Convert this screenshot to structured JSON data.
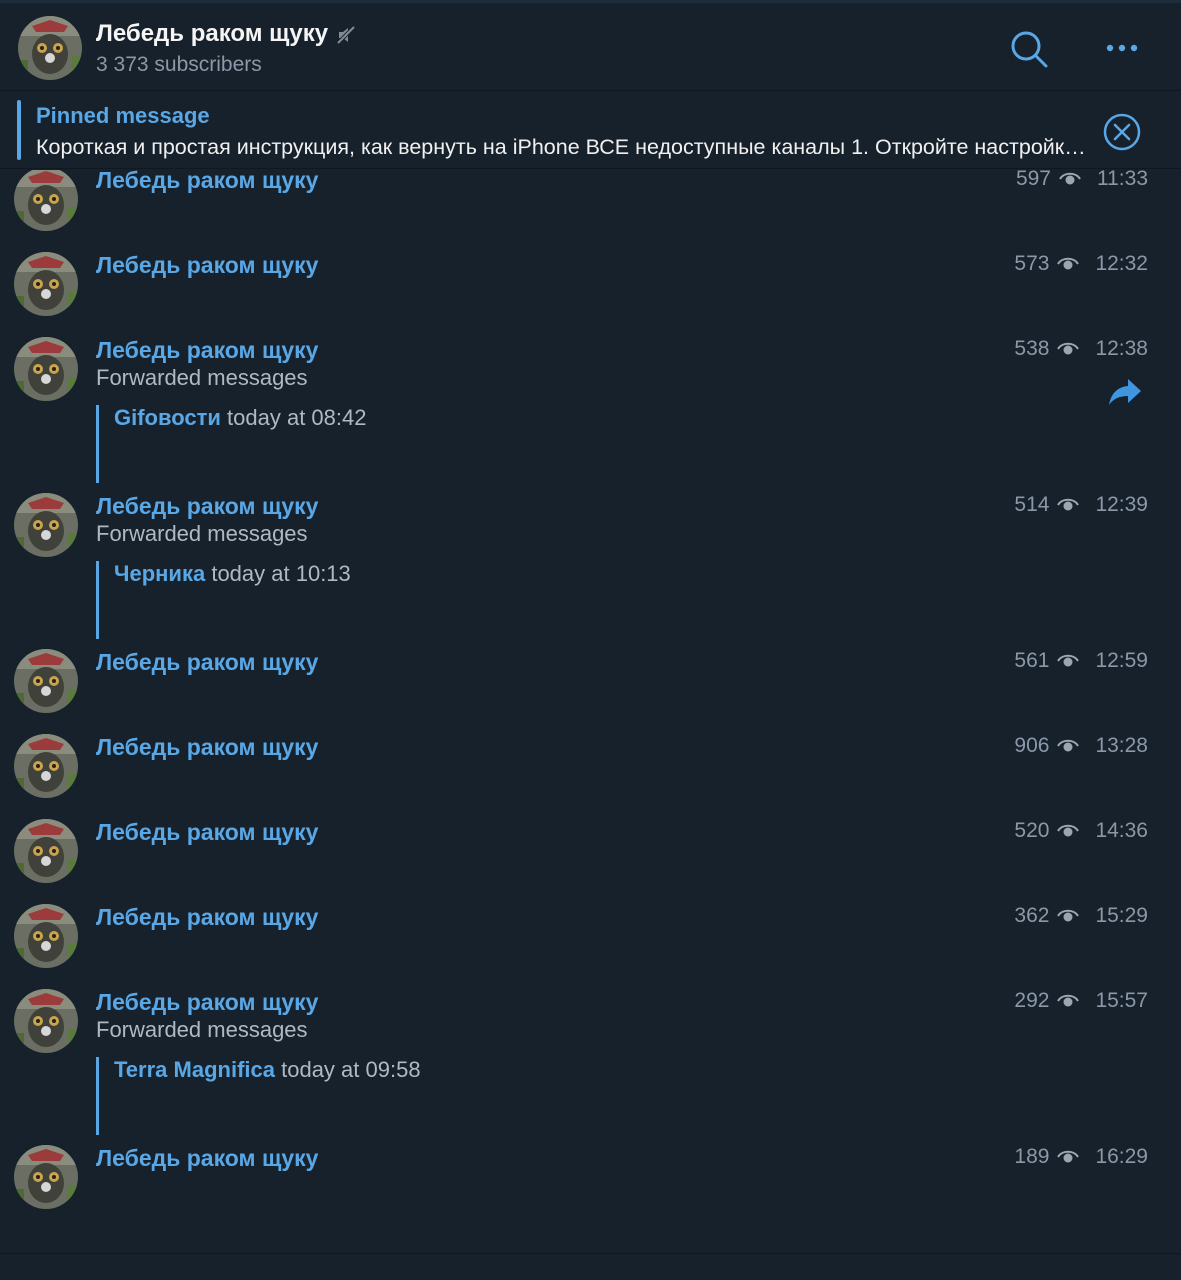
{
  "channel": {
    "title": "Лебедь раком щуку",
    "subscribers": "3 373 subscribers"
  },
  "header_icons": {
    "mute": "muted-speaker-icon",
    "search": "search-icon",
    "more": "more-dots-icon"
  },
  "pinned": {
    "title": "Pinned message",
    "text": "Короткая и простая инструкция, как вернуть на iPhone ВСЕ недоступные каналы  1. Откройте настройки Telegram"
  },
  "messages": [
    {
      "author": "Лебедь раком щуку",
      "views": "597",
      "time": "11:33",
      "forwarded": false
    },
    {
      "author": "Лебедь раком щуку",
      "views": "573",
      "time": "12:32",
      "forwarded": false
    },
    {
      "author": "Лебедь раком щуку",
      "views": "538",
      "time": "12:38",
      "forwarded": true,
      "fwd_label": "Forwarded messages",
      "fwd_source": "Gifовости",
      "fwd_time": "today at 08:42",
      "share": true
    },
    {
      "author": "Лебедь раком щуку",
      "views": "514",
      "time": "12:39",
      "forwarded": true,
      "fwd_label": "Forwarded messages",
      "fwd_source": "Черника",
      "fwd_time": "today at 10:13"
    },
    {
      "author": "Лебедь раком щуку",
      "views": "561",
      "time": "12:59",
      "forwarded": false
    },
    {
      "author": "Лебедь раком щуку",
      "views": "906",
      "time": "13:28",
      "forwarded": false
    },
    {
      "author": "Лебедь раком щуку",
      "views": "520",
      "time": "14:36",
      "forwarded": false
    },
    {
      "author": "Лебедь раком щуку",
      "views": "362",
      "time": "15:29",
      "forwarded": false
    },
    {
      "author": "Лебедь раком щуку",
      "views": "292",
      "time": "15:57",
      "forwarded": true,
      "fwd_label": "Forwarded messages",
      "fwd_source": "Terra Magnifica",
      "fwd_time": "today at 09:58"
    },
    {
      "author": "Лебедь раком щуку",
      "views": "189",
      "time": "16:29",
      "forwarded": false
    }
  ],
  "colors": {
    "background": "#17212b",
    "accent": "#5aa7e6",
    "muted_text": "#8a98a8"
  }
}
